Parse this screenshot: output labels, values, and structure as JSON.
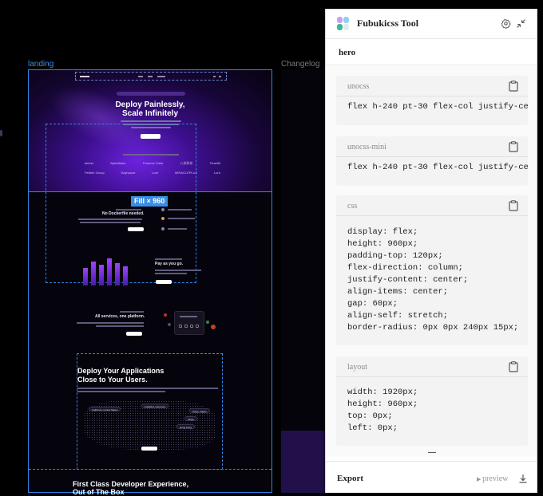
{
  "canvas": {
    "frames": {
      "landing_label": "landing",
      "changelog_label": "Changelog",
      "fill_badge": "Fill × 960"
    },
    "hero": {
      "title_line1": "Deploy Painlessly,",
      "title_line2": "Scale Infinitely",
      "logos_row1": [
        "airtest",
        "BytesBase",
        "Funerns Cista",
        "八米科技",
        "PearBit"
      ],
      "logos_row2": [
        "Pebble Group",
        "Dayhouse",
        "Lore",
        "MIRACLEPLUS",
        "Lore"
      ]
    },
    "features": {
      "block1_title": "No Dockerfile needed.",
      "block2_title": "Pay as you go.",
      "block3_title": "All services, one platform."
    },
    "globe": {
      "title_line1": "Deploy Your Applications",
      "title_line2": "Close to Your Users.",
      "tags": [
        "California, United States",
        "Frankfurt, Germany",
        "Tokyo, Japan",
        "Taipei",
        "Hong Kong"
      ]
    },
    "bottom": {
      "title_line1": "First Class Developer Experience,",
      "title_line2": "Out of The Box"
    }
  },
  "panel": {
    "title": "Fubukicss Tool",
    "section": "hero",
    "cards": [
      {
        "label": "unocss",
        "code": "flex h-240 pt-30 flex-col justify-ce"
      },
      {
        "label": "unocss-mini",
        "code": "flex h-240 pt-30 flex-col justify-ce"
      },
      {
        "label": "css",
        "code": "display: flex;\nheight: 960px;\npadding-top: 120px;\nflex-direction: column;\njustify-content: center;\nalign-items: center;\ngap: 60px;\nalign-self: stretch;\nborder-radius: 0px 0px 240px 15px;"
      },
      {
        "label": "layout",
        "code": "width: 1920px;\nheight: 960px;\ntop: 0px;\nleft: 0px;"
      }
    ],
    "footer": {
      "export_label": "Export",
      "preview_label": "preview"
    }
  },
  "colors": {
    "selection": "#2f86e8",
    "hero_purple": "#6d22e0",
    "panel_bg": "#ffffff"
  }
}
